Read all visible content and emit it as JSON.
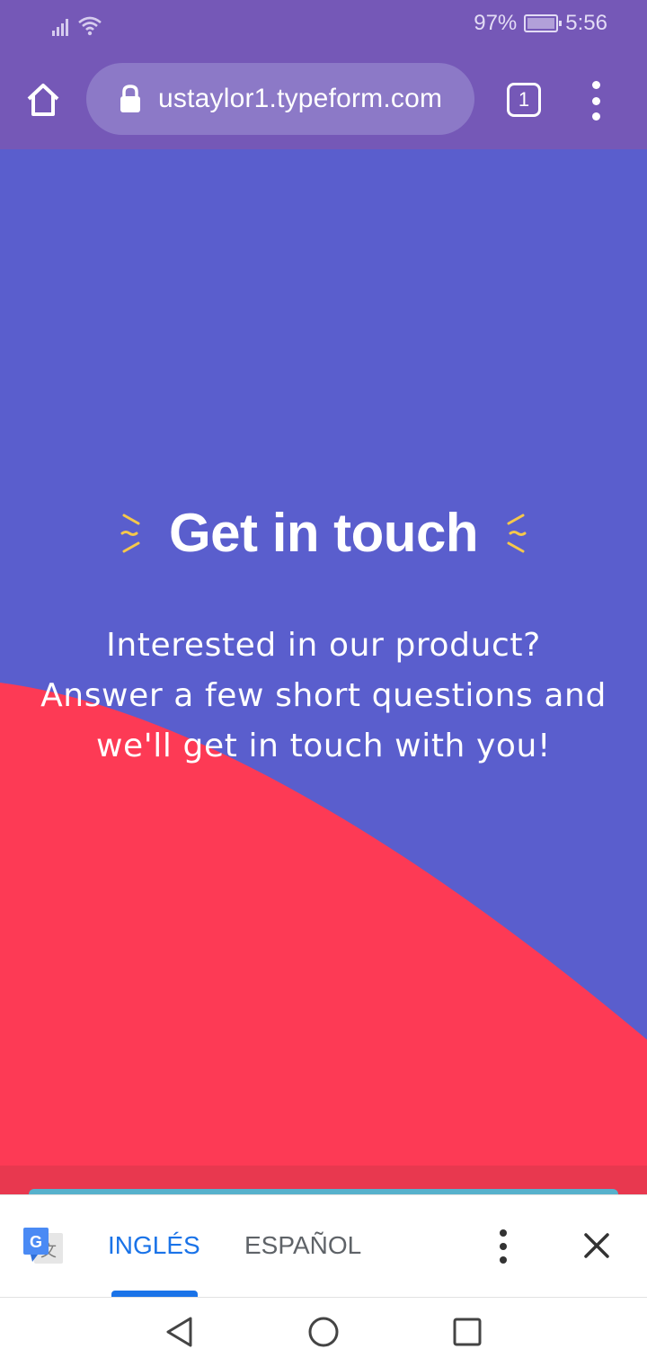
{
  "status_bar": {
    "battery_text": "97%",
    "time": "5:56",
    "icons": [
      "signal-icon",
      "wifi-icon",
      "battery-charging-icon"
    ]
  },
  "browser": {
    "url": "ustaylor1.typeform.com",
    "tab_count": "1",
    "icons": [
      "home-icon",
      "lock-icon",
      "tabs-icon",
      "more-vert-icon"
    ]
  },
  "page": {
    "title": "Get in touch",
    "subtitle_lines": [
      "Interested in our product?",
      "Answer a few short questions and",
      "we'll get in touch with you!"
    ],
    "colors": {
      "background": "#5a5ecd",
      "wave": "#fd3a55",
      "accent": "#f6c84a",
      "bar": "#57b1cc"
    }
  },
  "translate_bar": {
    "source_lang": "INGLÉS",
    "target_lang": "ESPAÑOL",
    "icons": [
      "google-translate-icon",
      "more-vert-icon",
      "close-icon"
    ]
  },
  "nav_bar": {
    "icons": [
      "back-icon",
      "home-circle-icon",
      "recents-icon"
    ]
  }
}
